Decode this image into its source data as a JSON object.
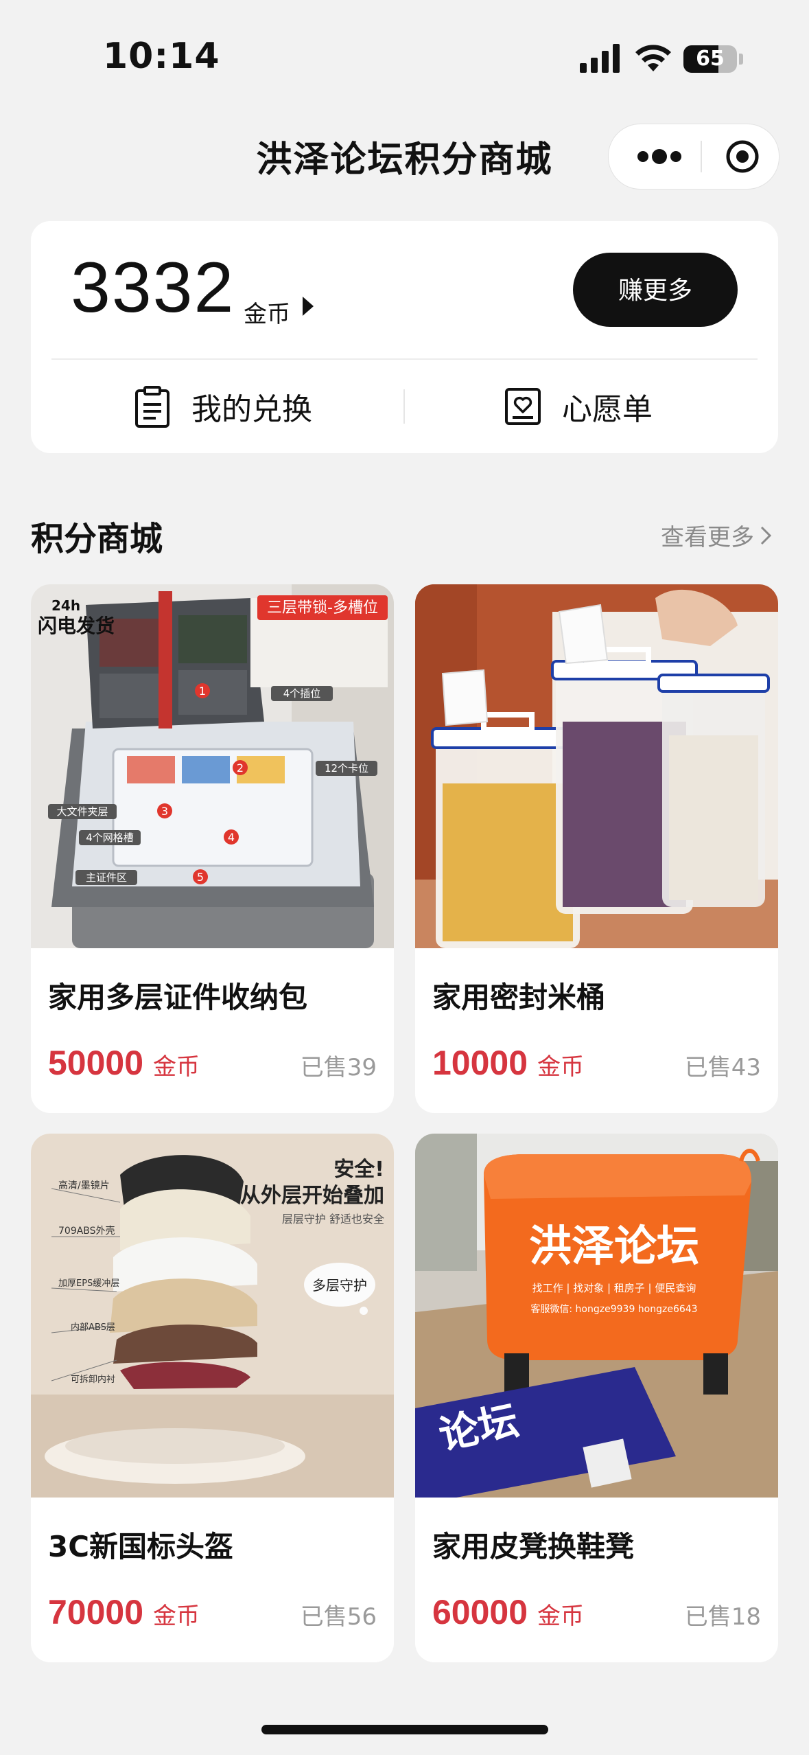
{
  "status_bar": {
    "time": "10:14",
    "battery": "65",
    "battery_level": 0.65
  },
  "nav": {
    "title": "洪泽论坛积分商城"
  },
  "wallet": {
    "coins": "3332",
    "unit": "金币",
    "earn_button": "赚更多",
    "my_exchange": "我的兑换",
    "wishlist": "心愿单"
  },
  "section": {
    "title": "积分商城",
    "more": "查看更多"
  },
  "products": [
    {
      "name": "家用多层证件收纳包",
      "price": "50000",
      "unit": "金币",
      "sold": "已售39",
      "image_text": {
        "badge_top": "24h",
        "badge_main": "闪电发货",
        "tag": "三层带锁-多槽位",
        "labels": [
          "4个插位",
          "12个卡位",
          "大文件夹层",
          "4个网格槽",
          "主证件区"
        ],
        "numbers": [
          "1",
          "2",
          "3",
          "4",
          "5"
        ]
      }
    },
    {
      "name": "家用密封米桶",
      "price": "10000",
      "unit": "金币",
      "sold": "已售43"
    },
    {
      "name": "3C新国标头盔",
      "price": "70000",
      "unit": "金币",
      "sold": "已售56",
      "image_text": {
        "headline1": "安全!",
        "headline2": "从外层开始叠加",
        "sub": "层层守护 舒适也安全",
        "bubble": "多层守护",
        "layers": [
          "高清/墨镜片",
          "709ABS外壳",
          "加厚EPS缓冲层",
          "内部ABS层",
          "可拆卸内衬"
        ]
      }
    },
    {
      "name": "家用皮凳换鞋凳",
      "price": "60000",
      "unit": "金币",
      "sold": "已售18",
      "image_text": {
        "logo": "洪泽论坛",
        "line1": "找工作 | 找对象 | 租房子 | 便民查询",
        "line2": "客服微信: hongze9939 hongze6643",
        "banner": "论坛"
      }
    }
  ]
}
